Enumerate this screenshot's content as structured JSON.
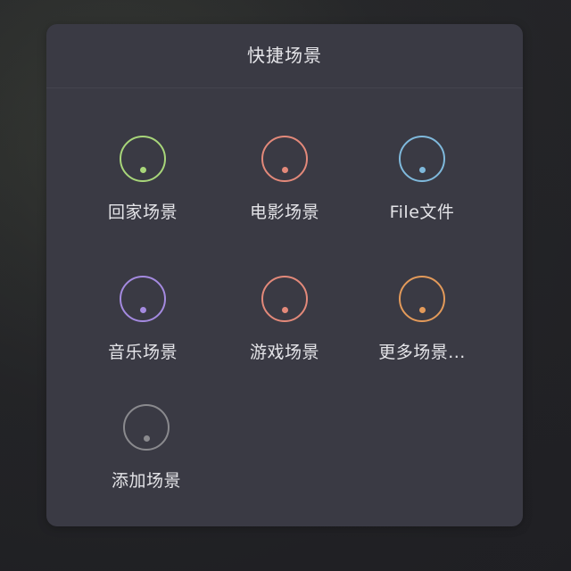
{
  "panel": {
    "title": "快捷场景"
  },
  "scenes": [
    {
      "label": "回家场景",
      "icon": "knob-icon",
      "color": "#a8d67a"
    },
    {
      "label": "电影场景",
      "icon": "knob-icon",
      "color": "#e3897a"
    },
    {
      "label": "File文件",
      "icon": "knob-icon",
      "color": "#7fb9dc"
    },
    {
      "label": "音乐场景",
      "icon": "knob-icon",
      "color": "#a48ae0"
    },
    {
      "label": "游戏场景",
      "icon": "knob-icon",
      "color": "#e3897a"
    },
    {
      "label": "更多场景...",
      "icon": "knob-icon",
      "color": "#e39a5a"
    },
    {
      "label": "添加场景",
      "icon": "knob-icon",
      "color": "#8a8a8e"
    }
  ]
}
